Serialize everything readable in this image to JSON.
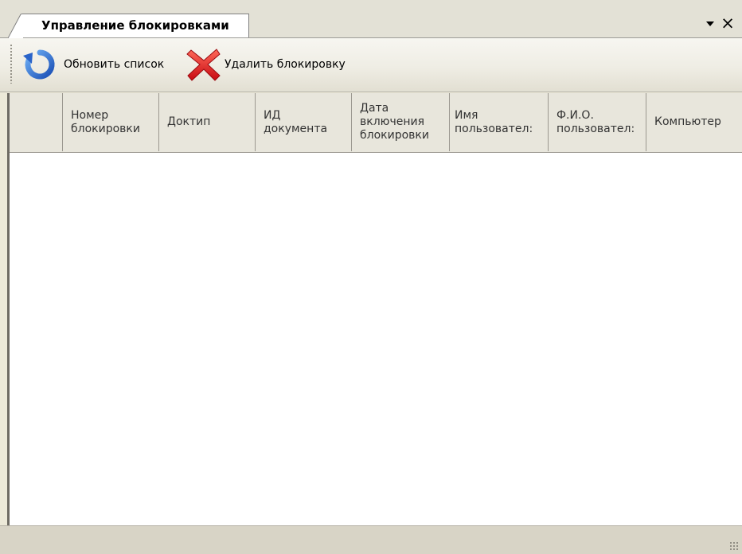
{
  "panel": {
    "tab_title": "Управление блокировками"
  },
  "toolbar": {
    "refresh_label": "Обновить список",
    "delete_label": "Удалить блокировку",
    "refresh_icon": "refresh-icon",
    "delete_icon": "red-x-icon"
  },
  "grid": {
    "columns": [
      "Номер\nблокировки",
      "Доктип",
      "ИД\nдокумента",
      "Дата\nвключения\nблокировки",
      "Имя\nпользовател:",
      "Ф.И.О.\nпользовател:",
      "Компьютер"
    ],
    "rows": []
  },
  "colors": {
    "accent_blue": "#2f6fd4",
    "delete_red": "#e0141a"
  }
}
